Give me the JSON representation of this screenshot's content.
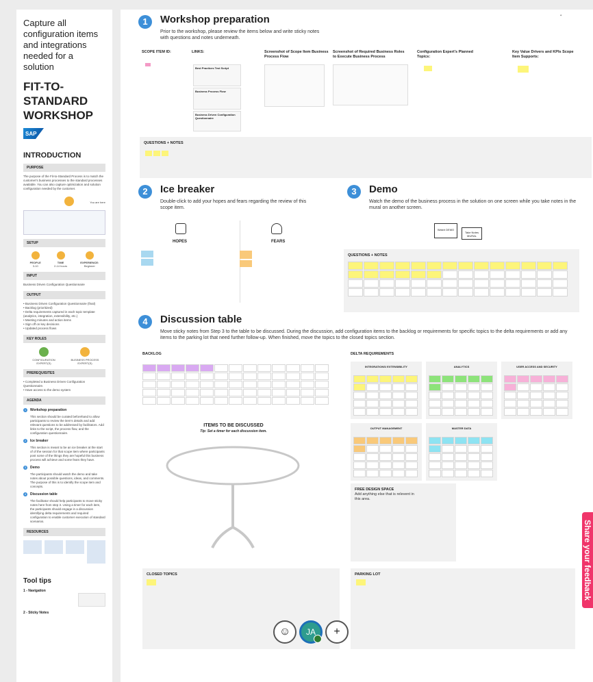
{
  "sidebar": {
    "capture_title": "Capture all configuration items and integrations needed for a solution",
    "workshop_title": "FIT-TO-STANDARD WORKSHOP",
    "sap_logo": "SAP",
    "intro_heading": "INTRODUCTION",
    "purpose_tag": "PURPOSE",
    "purpose_text": "The purpose of the Fit-to-Standard Process is to match the customer's business processes to the standard processes available. You can also capture optimization and solution configuration needed by the customer.",
    "you_are_here": "You are here",
    "setup_tag": "SETUP",
    "setup": [
      {
        "label": "PEOPLE",
        "value": "3-10"
      },
      {
        "label": "TIME",
        "value": "2-14 hours"
      },
      {
        "label": "EXPERIENCE:",
        "value": "Beginner"
      }
    ],
    "input_tag": "INPUT",
    "input_text": "Business Driven Configuration Questionnaire",
    "output_tag": "OUTPUT",
    "output_items": [
      "• Business Driven Configuration Questionnaire (final)",
      "• Backlog (prioritized)",
      "• Delta requirements captured in each topic template (analytics, integration, extensibility, etc.)",
      "• Meeting minutes and action items",
      "• Sign off on key decisions",
      "• Updated process flows"
    ],
    "roles_tag": "KEY ROLES",
    "roles": [
      "CONFIGURATION EXPERT(S)",
      "BUSINESS PROCESS EXPERT(S)"
    ],
    "prereq_tag": "PREREQUISITES",
    "prereq_items": [
      "• Completed a Business Driven Configuration Questionnaire.",
      "• Have access to the demo system"
    ],
    "agenda_tag": "AGENDA",
    "agenda": [
      {
        "num": "1",
        "title": "Workshop preparation",
        "text": "This section should be curated beforehand to allow participants to review the item's details and add relevant questions to be addressed by facilitators. Add links to the script, the process flow, and the configuration questionnaire."
      },
      {
        "num": "2",
        "title": "Ice breaker",
        "text": "This section is meant to be an ice breaker at the start of of the session for that scope item where participants post some of the things they are hopeful this business process will achieve and some fears they have."
      },
      {
        "num": "3",
        "title": "Demo",
        "text": "The participants should watch the demo and take notes about possible questions, ideas, and comments. The purpose of this is to identify the scope item and concepts."
      },
      {
        "num": "4",
        "title": "Discussion table",
        "text": "The facilitator should help participants to move sticky notes here from step 3. Using a timer for each item, the participants should engage in a discussion identifying delta requirements and required configuration to enable customer execution of standard scenarios."
      }
    ],
    "resources_tag": "RESOURCES",
    "tooltips_title": "Tool tips",
    "tip1": "1 - Navigation",
    "tip2": "2 - Sticky Notes"
  },
  "workshop": {
    "num": "1",
    "title": "Workshop preparation",
    "subtitle": "Prior to the workshop, please review the items below and write sticky notes with questions and notes underneath.",
    "scope_id": "SCOPE ITEM ID:",
    "links": "LINKS:",
    "link_cards": [
      "Best Practices Test Script",
      "Business Process Flow",
      "Business Driven Configuration Questionnaire"
    ],
    "col_flow": "Screenshot of Scope Item Business Process Flow",
    "col_roles": "Screenshot of Required Business Roles to Execute Business Process",
    "col_expert": "Configuration Expert's Planned Topics:",
    "col_kpi": "Key Value Drivers and KPIs Scope Item Supports:",
    "questions": "QUESTIONS + NOTES"
  },
  "icebreaker": {
    "num": "2",
    "title": "Ice breaker",
    "subtitle": "Double-click to add your hopes and fears regarding the review of this scope item.",
    "hopes": "HOPES",
    "fears": "FEARS"
  },
  "demo": {
    "num": "3",
    "title": "Demo",
    "subtitle": "Watch the demo of the business process in the solution on one screen while you take notes in the mural on another screen.",
    "watch": "Watch DEMO",
    "take_notes": "Take Notes MURAL",
    "questions": "QUESTIONS + NOTES"
  },
  "discussion": {
    "num": "4",
    "title": "Discussion table",
    "subtitle": "Move sticky notes from Step 3 to the table to be discussed. During the discussion, add configuration items to the backlog or requirements for specific topics to the delta requirements or add any items to the parking lot that need further follow-up. When finished, move the topics to the closed topics section.",
    "backlog": "BACKLOG",
    "delta": "DELTA REQUIREMENTS",
    "delta_panels": [
      "INTEGRATIONS/ EXTENSIBILITY",
      "ANALYTICS",
      "USER ACCESS AND SECURITY",
      "OUTPUT MANAGEMENT",
      "MASTER DATA"
    ],
    "items_title": "ITEMS TO BE DISCUSSED",
    "items_tip": "Tip: Set a timer for each discussion item.",
    "free_title": "FREE DESIGN SPACE",
    "free_text": "Add anything else that is relevent in this area.",
    "closed": "CLOSED TOPICS",
    "parking": "PARKING LOT"
  },
  "feedback": "Share your feedback",
  "toolbar": {
    "avatar": "JA",
    "add": "+"
  }
}
